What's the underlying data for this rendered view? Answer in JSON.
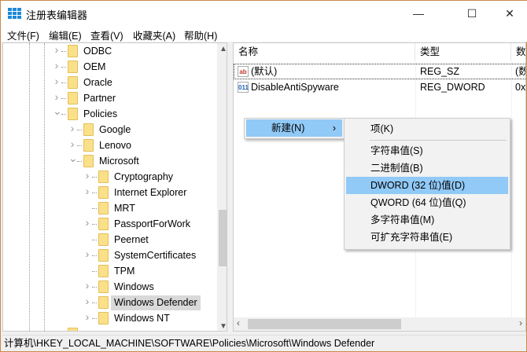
{
  "window": {
    "title": "注册表编辑器",
    "min": "—",
    "max": "☐",
    "close": "✕"
  },
  "menu": [
    "文件(F)",
    "编辑(E)",
    "查看(V)",
    "收藏夹(A)",
    "帮助(H)"
  ],
  "tree": [
    {
      "label": "ODBC",
      "level": 0,
      "state": "collapsed"
    },
    {
      "label": "OEM",
      "level": 0,
      "state": "collapsed"
    },
    {
      "label": "Oracle",
      "level": 0,
      "state": "collapsed"
    },
    {
      "label": "Partner",
      "level": 0,
      "state": "collapsed"
    },
    {
      "label": "Policies",
      "level": 0,
      "state": "expanded"
    },
    {
      "label": "Google",
      "level": 1,
      "state": "collapsed"
    },
    {
      "label": "Lenovo",
      "level": 1,
      "state": "collapsed"
    },
    {
      "label": "Microsoft",
      "level": 1,
      "state": "expanded"
    },
    {
      "label": "Cryptography",
      "level": 2,
      "state": "collapsed"
    },
    {
      "label": "Internet Explorer",
      "level": 2,
      "state": "collapsed"
    },
    {
      "label": "MRT",
      "level": 2,
      "state": "none"
    },
    {
      "label": "PassportForWork",
      "level": 2,
      "state": "collapsed"
    },
    {
      "label": "Peernet",
      "level": 2,
      "state": "none"
    },
    {
      "label": "SystemCertificates",
      "level": 2,
      "state": "collapsed"
    },
    {
      "label": "TPM",
      "level": 2,
      "state": "none"
    },
    {
      "label": "Windows",
      "level": 2,
      "state": "collapsed"
    },
    {
      "label": "Windows Defender",
      "level": 2,
      "state": "collapsed",
      "selected": true
    },
    {
      "label": "Windows NT",
      "level": 2,
      "state": "collapsed"
    }
  ],
  "columns": {
    "name": "名称",
    "type": "类型",
    "data": "数"
  },
  "values": [
    {
      "icon": "ab",
      "name": "(默认)",
      "type": "REG_SZ",
      "data": "(数"
    },
    {
      "icon": "011",
      "name": "DisableAntiSpyware",
      "type": "REG_DWORD",
      "data": "0x"
    }
  ],
  "context_menu": {
    "new_label": "新建(N)",
    "arrow": "›"
  },
  "submenu": {
    "key": "项(K)",
    "items": [
      "字符串值(S)",
      "二进制值(B)",
      "DWORD (32 位)值(D)",
      "QWORD (64 位)值(Q)",
      "多字符串值(M)",
      "可扩充字符串值(E)"
    ],
    "highlighted": 2
  },
  "status": "计算机\\HKEY_LOCAL_MACHINE\\SOFTWARE\\Policies\\Microsoft\\Windows Defender",
  "colors": {
    "highlight": "#91c9f7",
    "folder": "#fbe08a",
    "border": "#c98a4a"
  }
}
